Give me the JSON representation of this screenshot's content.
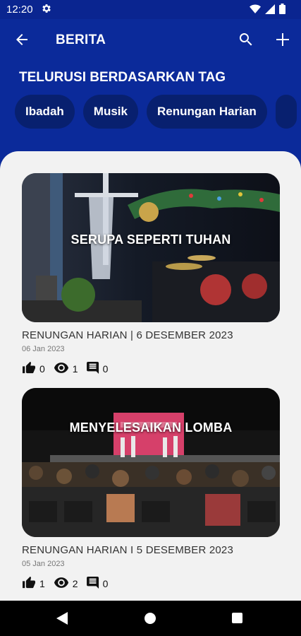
{
  "status_bar": {
    "time": "12:20",
    "icons": [
      "gear-icon",
      "wifi-icon",
      "signal-icon",
      "battery-icon"
    ]
  },
  "app_bar": {
    "title": "BERITA",
    "icons": [
      "arrow-left-icon",
      "search-icon",
      "plus-icon"
    ]
  },
  "tags": {
    "heading": "TELURUSI BERDASARKAN TAG",
    "chips": [
      "Ibadah",
      "Musik",
      "Renungan Harian"
    ]
  },
  "articles": [
    {
      "image_caption": "SERUPA SEPERTI TUHAN",
      "title": "RENUNGAN HARIAN | 6 DESEMBER 2023",
      "date": "06 Jan 2023",
      "likes": "0",
      "views": "1",
      "comments": "0"
    },
    {
      "image_caption": "MENYELESAIKAN LOMBA",
      "title": "RENUNGAN HARIAN I 5 DESEMBER 2023",
      "date": "05 Jan 2023",
      "likes": "1",
      "views": "2",
      "comments": "0"
    }
  ],
  "colors": {
    "primary": "#0b2a9a",
    "chip": "#08206f",
    "panel": "#f2f2f2"
  }
}
